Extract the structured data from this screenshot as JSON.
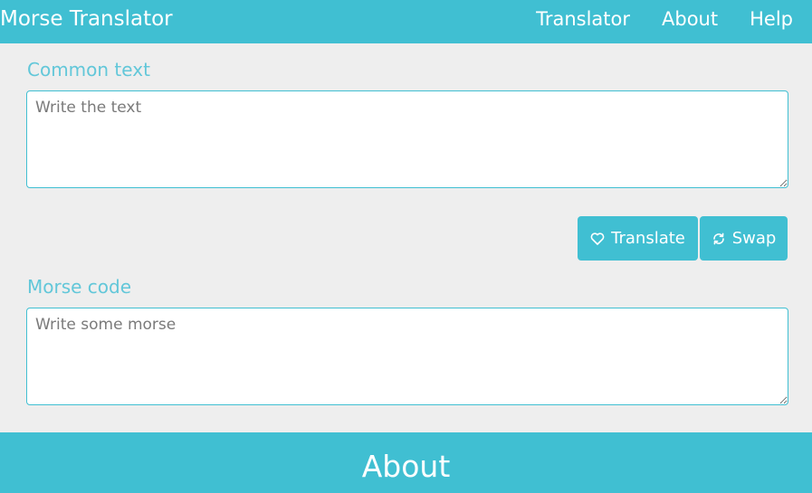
{
  "brand": "Morse Translator",
  "nav": {
    "translator": "Translator",
    "about": "About",
    "help": "Help"
  },
  "common": {
    "label": "Common text",
    "placeholder": "Write the text"
  },
  "morse": {
    "label": "Morse code",
    "placeholder": "Write some morse"
  },
  "buttons": {
    "translate_label": "Translate",
    "translate_icon": "heart-icon",
    "swap_label": "Swap",
    "swap_icon": "refresh-icon"
  },
  "about_section": {
    "title": "About"
  },
  "colors": {
    "accent": "#40bfd2",
    "label": "#62c7d9",
    "background": "#eeeeee"
  }
}
